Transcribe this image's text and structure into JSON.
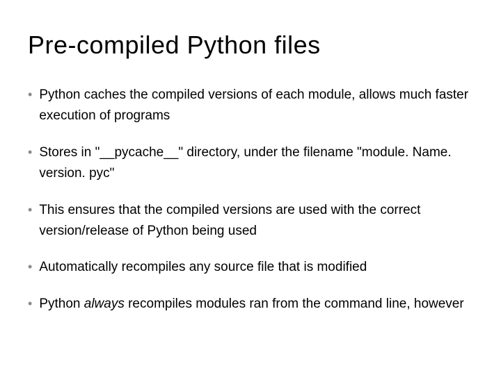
{
  "slide": {
    "title": "Pre-compiled Python files",
    "bullets": [
      {
        "segments": [
          {
            "text": "Python caches the compiled versions of each module, allows much faster execution of programs",
            "italic": false
          }
        ]
      },
      {
        "segments": [
          {
            "text": "Stores in \"__pycache__\" directory, under the filename \"module. Name. version. pyc\"",
            "italic": false
          }
        ]
      },
      {
        "segments": [
          {
            "text": "This ensures that the compiled versions are used with the correct version/release of Python being used",
            "italic": false
          }
        ]
      },
      {
        "segments": [
          {
            "text": "Automatically recompiles any source file that is modified",
            "italic": false
          }
        ]
      },
      {
        "segments": [
          {
            "text": "Python ",
            "italic": false
          },
          {
            "text": "always",
            "italic": true
          },
          {
            "text": " recompiles modules ran from the command line, however",
            "italic": false
          }
        ]
      }
    ]
  }
}
